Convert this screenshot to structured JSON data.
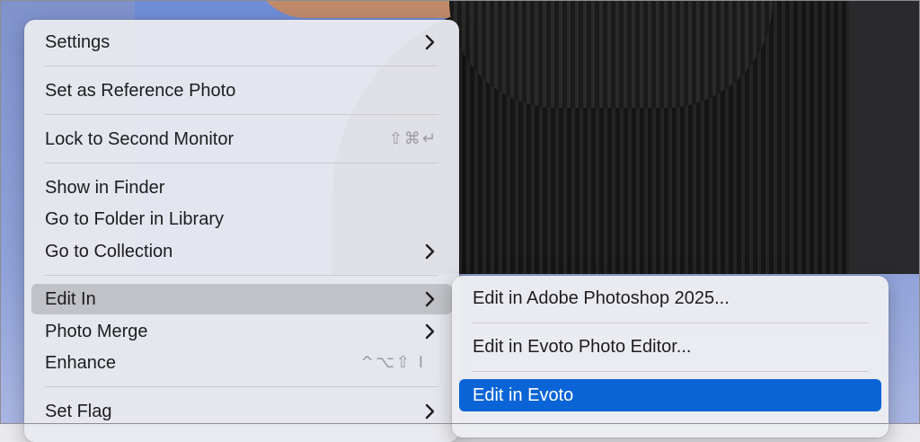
{
  "menu": {
    "settings": "Settings",
    "set_reference": "Set as Reference Photo",
    "lock_second_monitor": "Lock to Second Monitor",
    "lock_shortcut": "⇧⌘↵",
    "show_in_finder": "Show in Finder",
    "go_to_folder": "Go to Folder in Library",
    "go_to_collection": "Go to Collection",
    "edit_in": "Edit In",
    "photo_merge": "Photo Merge",
    "enhance": "Enhance",
    "enhance_shortcut": "^⌥⇧ I",
    "set_flag": "Set Flag"
  },
  "submenu": {
    "photoshop": "Edit in Adobe Photoshop 2025...",
    "evoto_editor": "Edit in Evoto Photo Editor...",
    "evoto": "Edit in Evoto"
  },
  "colors": {
    "selection": "#0a64d6",
    "hover": "#c8c8cc"
  }
}
